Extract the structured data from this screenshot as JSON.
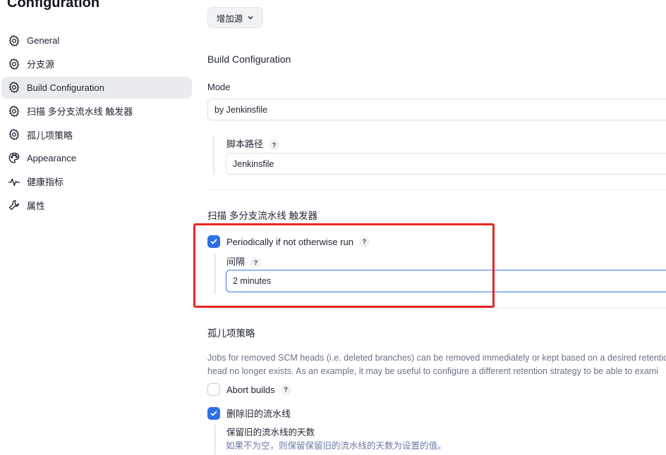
{
  "page_title": "Configuration",
  "sidebar": {
    "items": [
      {
        "label": "General",
        "icon": "gear-icon"
      },
      {
        "label": "分支源",
        "icon": "gear-icon"
      },
      {
        "label": "Build Configuration",
        "icon": "gear-icon",
        "active": true
      },
      {
        "label": "扫描 多分支流水线 触发器",
        "icon": "gear-icon"
      },
      {
        "label": "孤儿项策略",
        "icon": "gear-icon"
      },
      {
        "label": "Appearance",
        "icon": "palette-icon"
      },
      {
        "label": "健康指标",
        "icon": "pulse-icon"
      },
      {
        "label": "属性",
        "icon": "wrench-icon"
      }
    ]
  },
  "main": {
    "add_source_label": "增加源",
    "build_config": {
      "heading": "Build Configuration",
      "mode_label": "Mode",
      "mode_value": "by Jenkinsfile",
      "script_path_label": "脚本路径",
      "script_path_value": "Jenkinsfile",
      "help_text": "?"
    },
    "scan_trigger": {
      "heading": "扫描 多分支流水线 触发器",
      "periodic_label": "Periodically if not otherwise run",
      "periodic_checked": true,
      "interval_label": "间隔",
      "interval_value": "2 minutes",
      "help_text": "?"
    },
    "orphan": {
      "heading": "孤儿项策略",
      "description_line1": "Jobs for removed SCM heads (i.e. deleted branches) can be removed immediately or kept based on a desired retentic",
      "description_line2": "head no longer exists. As an example, it may be useful to configure a different retention strategy to be able to exami",
      "abort_label": "Abort builds",
      "abort_checked": false,
      "delete_label": "删除旧的流水线",
      "delete_checked": true,
      "days_label": "保留旧的流水线的天数",
      "days_hint": "如果不为空，则保留保留旧的流水线的天数为设置的值。",
      "help_text": "?"
    }
  },
  "colors": {
    "accent": "#2f6fe4",
    "highlight_box": "#e8261f",
    "active_sidebar": "#e9ebef"
  }
}
